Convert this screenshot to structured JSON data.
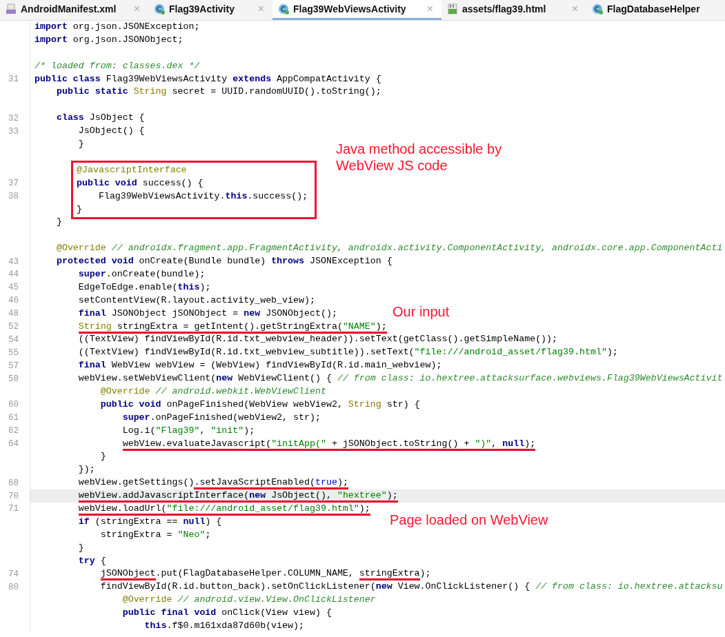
{
  "tabs": [
    {
      "label": "AndroidManifest.xml",
      "kind": "manifest",
      "selected": false,
      "closable": true
    },
    {
      "label": "Flag39Activity",
      "kind": "class",
      "selected": false,
      "closable": true
    },
    {
      "label": "Flag39WebViewsActivity",
      "kind": "class",
      "selected": true,
      "closable": true
    },
    {
      "label": "assets/flag39.html",
      "kind": "html",
      "selected": false,
      "closable": true
    },
    {
      "label": "FlagDatabaseHelper",
      "kind": "class",
      "selected": false,
      "closable": false
    }
  ],
  "close_glyph": "×",
  "lines": [
    {
      "kind": "line",
      "current": false,
      "tokens": [
        {
          "kind": "kw",
          "text": "import"
        },
        {
          "kind": "plain",
          "text": " org.json.JSONException;"
        }
      ]
    },
    {
      "kind": "line",
      "current": false,
      "tokens": [
        {
          "kind": "kw",
          "text": "import"
        },
        {
          "kind": "plain",
          "text": " org.json.JSONObject;"
        }
      ]
    },
    {
      "kind": "line",
      "current": false
    },
    {
      "kind": "line",
      "current": false,
      "tokens": [
        {
          "kind": "comment",
          "text": "/* loaded from: classes.dex */"
        }
      ]
    },
    {
      "kind": "line",
      "number": "31",
      "current": false,
      "tokens": [
        {
          "kind": "kw",
          "text": "public class"
        },
        {
          "kind": "plain",
          "text": " Flag39WebViewsActivity "
        },
        {
          "kind": "kw",
          "text": "extends"
        },
        {
          "kind": "plain",
          "text": " AppCompatActivity {"
        }
      ]
    },
    {
      "kind": "line",
      "current": false,
      "tokens": [
        {
          "kind": "kw",
          "text": "    public static"
        },
        {
          "kind": "type",
          "text": " String"
        },
        {
          "kind": "plain",
          "text": " secret = UUID.randomUUID().toString();"
        }
      ]
    },
    {
      "kind": "line",
      "current": false
    },
    {
      "kind": "line",
      "number": "32",
      "current": false,
      "tokens": [
        {
          "kind": "kw",
          "text": "    class"
        },
        {
          "kind": "plain",
          "text": " JsObject {"
        }
      ]
    },
    {
      "kind": "line",
      "number": "33",
      "current": false,
      "tokens": [
        {
          "kind": "plain",
          "text": "        JsObject() {"
        }
      ]
    },
    {
      "kind": "line",
      "current": false,
      "tokens": [
        {
          "kind": "plain",
          "text": "        }"
        }
      ]
    },
    {
      "kind": "line",
      "current": false
    },
    {
      "kind": "boxed",
      "lines": [
        {
          "kind": "line",
          "current": false,
          "tokens": [
            {
              "kind": "annotation",
              "text": "@JavascriptInterface"
            }
          ]
        },
        {
          "kind": "line",
          "number": "37",
          "current": false,
          "tokens": [
            {
              "kind": "kw",
              "text": "public void"
            },
            {
              "kind": "plain",
              "text": " success() {"
            }
          ]
        },
        {
          "kind": "line",
          "number": "38",
          "current": false,
          "tokens": [
            {
              "kind": "plain",
              "text": "    Flag39WebViewsActivity."
            },
            {
              "kind": "kw",
              "text": "this"
            },
            {
              "kind": "plain",
              "text": ".success();"
            }
          ]
        },
        {
          "kind": "line",
          "current": false,
          "tokens": [
            {
              "kind": "plain",
              "text": "}"
            }
          ]
        }
      ]
    },
    {
      "kind": "line",
      "current": false,
      "tokens": [
        {
          "kind": "plain",
          "text": "    }"
        }
      ]
    },
    {
      "kind": "line",
      "current": false
    },
    {
      "kind": "line",
      "current": false,
      "tokens": [
        {
          "kind": "annotation",
          "text": "    @Override"
        },
        {
          "kind": "comment",
          "text": " // androidx.fragment.app.FragmentActivity, androidx.activity.ComponentActivity, androidx.core.app.ComponentActi"
        }
      ]
    },
    {
      "kind": "line",
      "number": "43",
      "current": false,
      "tokens": [
        {
          "kind": "kw",
          "text": "    protected void"
        },
        {
          "kind": "plain",
          "text": " onCreate(Bundle bundle) "
        },
        {
          "kind": "kw",
          "text": "throws"
        },
        {
          "kind": "plain",
          "text": " JSONException {"
        }
      ]
    },
    {
      "kind": "line",
      "number": "44",
      "current": false,
      "tokens": [
        {
          "kind": "kw",
          "text": "        super"
        },
        {
          "kind": "plain",
          "text": ".onCreate(bundle);"
        }
      ]
    },
    {
      "kind": "line",
      "number": "45",
      "current": false,
      "tokens": [
        {
          "kind": "plain",
          "text": "        EdgeToEdge.enable("
        },
        {
          "kind": "kw",
          "text": "this"
        },
        {
          "kind": "plain",
          "text": ");"
        }
      ]
    },
    {
      "kind": "line",
      "number": "46",
      "current": false,
      "tokens": [
        {
          "kind": "plain",
          "text": "        setContentView(R.layout.activity_web_view);"
        }
      ]
    },
    {
      "kind": "line",
      "number": "48",
      "current": false,
      "tokens": [
        {
          "kind": "kw",
          "text": "        final"
        },
        {
          "kind": "plain",
          "text": " JSONObject jSONObject = "
        },
        {
          "kind": "kw",
          "text": "new"
        },
        {
          "kind": "plain",
          "text": " JSONObject();"
        }
      ]
    },
    {
      "kind": "line",
      "number": "52",
      "current": false,
      "tokens": [
        {
          "kind": "type",
          "text": "        String",
          "underlined": true
        },
        {
          "kind": "plain",
          "text": " stringExtra = getIntent().getStringExtra(",
          "underlined": true
        },
        {
          "kind": "string",
          "text": "\"NAME\"",
          "underlined": true
        },
        {
          "kind": "plain",
          "text": ");",
          "underlined": true
        }
      ]
    },
    {
      "kind": "line",
      "number": "54",
      "current": false,
      "tokens": [
        {
          "kind": "plain",
          "text": "        ((TextView) findViewById(R.id.txt_webview_header)).setText(getClass().getSimpleName());"
        }
      ]
    },
    {
      "kind": "line",
      "number": "55",
      "current": false,
      "tokens": [
        {
          "kind": "plain",
          "text": "        ((TextView) findViewById(R.id.txt_webview_subtitle)).setText("
        },
        {
          "kind": "string",
          "text": "\"file:///android_asset/flag39.html\""
        },
        {
          "kind": "plain",
          "text": ");"
        }
      ]
    },
    {
      "kind": "line",
      "number": "57",
      "current": false,
      "tokens": [
        {
          "kind": "kw",
          "text": "        final"
        },
        {
          "kind": "plain",
          "text": " WebView webView = (WebView) findViewById(R.id.main_webview);"
        }
      ]
    },
    {
      "kind": "line",
      "number": "58",
      "current": false,
      "tokens": [
        {
          "kind": "plain",
          "text": "        webView.setWebViewClient("
        },
        {
          "kind": "kw",
          "text": "new"
        },
        {
          "kind": "plain",
          "text": " WebViewClient() { "
        },
        {
          "kind": "comment",
          "text": "// from class: io.hextree.attacksurface.webviews.Flag39WebViewsActivit"
        }
      ]
    },
    {
      "kind": "line",
      "current": false,
      "tokens": [
        {
          "kind": "annotation",
          "text": "            @Override"
        },
        {
          "kind": "comment",
          "text": " // android.webkit.WebViewClient"
        }
      ]
    },
    {
      "kind": "line",
      "number": "60",
      "current": false,
      "tokens": [
        {
          "kind": "kw",
          "text": "            public void"
        },
        {
          "kind": "plain",
          "text": " onPageFinished(WebView webView2, "
        },
        {
          "kind": "type",
          "text": "String"
        },
        {
          "kind": "plain",
          "text": " str) {"
        }
      ]
    },
    {
      "kind": "line",
      "number": "61",
      "current": false,
      "tokens": [
        {
          "kind": "kw",
          "text": "                super"
        },
        {
          "kind": "plain",
          "text": ".onPageFinished(webView2, str);"
        }
      ]
    },
    {
      "kind": "line",
      "number": "62",
      "current": false,
      "tokens": [
        {
          "kind": "plain",
          "text": "                Log.i("
        },
        {
          "kind": "string",
          "text": "\"Flag39\""
        },
        {
          "kind": "plain",
          "text": ", "
        },
        {
          "kind": "string",
          "text": "\"init\""
        },
        {
          "kind": "plain",
          "text": ");"
        }
      ]
    },
    {
      "kind": "line",
      "number": "64",
      "current": false,
      "tokens": [
        {
          "kind": "plain",
          "text": "                webView.evaluateJavascript(",
          "underlined": true
        },
        {
          "kind": "string",
          "text": "\"initApp(\"",
          "underlined": true
        },
        {
          "kind": "plain",
          "text": " + jSONObject.toString() + ",
          "underlined": true
        },
        {
          "kind": "string",
          "text": "\")\"",
          "underlined": true
        },
        {
          "kind": "plain",
          "text": ", ",
          "underlined": true
        },
        {
          "kind": "kw",
          "text": "null",
          "underlined": true
        },
        {
          "kind": "plain",
          "text": ");",
          "underlined": true
        }
      ]
    },
    {
      "kind": "line",
      "current": false,
      "tokens": [
        {
          "kind": "plain",
          "text": "            }"
        }
      ]
    },
    {
      "kind": "line",
      "current": false,
      "tokens": [
        {
          "kind": "plain",
          "text": "        });"
        }
      ]
    },
    {
      "kind": "line",
      "number": "68",
      "current": false,
      "tokens": [
        {
          "kind": "plain",
          "text": "        webView.getSettings()"
        },
        {
          "kind": "plain",
          "text": ".setJavaScriptEnabled(",
          "underlined": true
        },
        {
          "kind": "literal",
          "text": "true",
          "underlined": true
        },
        {
          "kind": "plain",
          "text": ");",
          "underlined": true
        }
      ]
    },
    {
      "kind": "line",
      "number": "70",
      "current": true,
      "tokens": [
        {
          "kind": "plain",
          "text": "        webView.addJavascriptInterface(",
          "underlined": true
        },
        {
          "kind": "kw",
          "text": "new",
          "underlined": true
        },
        {
          "kind": "plain",
          "text": " JsObject(), ",
          "underlined": true
        },
        {
          "kind": "string",
          "text": "\"hextree\"",
          "underlined": true
        },
        {
          "kind": "plain",
          "text": ");",
          "underlined": true
        }
      ]
    },
    {
      "kind": "line",
      "number": "71",
      "current": false,
      "tokens": [
        {
          "kind": "plain",
          "text": "        webView.loadUrl(",
          "underlined": true
        },
        {
          "kind": "string",
          "text": "\"file:///android_asset/flag39.html\"",
          "underlined": true
        },
        {
          "kind": "plain",
          "text": ");",
          "underlined": true
        }
      ]
    },
    {
      "kind": "line",
      "current": false,
      "tokens": [
        {
          "kind": "kw",
          "text": "        if"
        },
        {
          "kind": "plain",
          "text": " (stringExtra == "
        },
        {
          "kind": "kw",
          "text": "null"
        },
        {
          "kind": "plain",
          "text": ") {"
        }
      ]
    },
    {
      "kind": "line",
      "current": false,
      "tokens": [
        {
          "kind": "plain",
          "text": "            stringExtra = "
        },
        {
          "kind": "string",
          "text": "\"Neo\""
        },
        {
          "kind": "plain",
          "text": ";"
        }
      ]
    },
    {
      "kind": "line",
      "current": false,
      "tokens": [
        {
          "kind": "plain",
          "text": "        }"
        }
      ]
    },
    {
      "kind": "line",
      "current": false,
      "tokens": [
        {
          "kind": "kw",
          "text": "        try"
        },
        {
          "kind": "plain",
          "text": " {"
        }
      ]
    },
    {
      "kind": "line",
      "number": "74",
      "current": false,
      "tokens": [
        {
          "kind": "plain",
          "text": "            jSONObject",
          "underlined": true
        },
        {
          "kind": "plain",
          "text": ".put(FlagDatabaseHelper.COLUMN_NAME, "
        },
        {
          "kind": "plain",
          "text": "stringExtra",
          "underlined": true
        },
        {
          "kind": "plain",
          "text": ");"
        }
      ]
    },
    {
      "kind": "line",
      "number": "80",
      "current": false,
      "tokens": [
        {
          "kind": "plain",
          "text": "            findViewById(R.id.button_back).setOnClickListener("
        },
        {
          "kind": "kw",
          "text": "new"
        },
        {
          "kind": "plain",
          "text": " View.OnClickListener() { "
        },
        {
          "kind": "comment",
          "text": "// from class: io.hextree.attacksu"
        }
      ]
    },
    {
      "kind": "line",
      "current": false,
      "tokens": [
        {
          "kind": "annotation",
          "text": "                @Override"
        },
        {
          "kind": "comment",
          "text": " // android.view.View.OnClickListener"
        }
      ]
    },
    {
      "kind": "line",
      "current": false,
      "tokens": [
        {
          "kind": "kw",
          "text": "                public final void"
        },
        {
          "kind": "plain",
          "text": " onClick(View view) {"
        }
      ]
    },
    {
      "kind": "line",
      "current": false,
      "tokens": [
        {
          "kind": "kw",
          "text": "                    this"
        },
        {
          "kind": "plain",
          "text": ".f$0.m161xda87d60b(view);"
        }
      ]
    }
  ],
  "notes": [
    {
      "text": "Java method accessible by WebView JS code"
    },
    {
      "text": "Our input"
    },
    {
      "text": "Page loaded on WebView"
    }
  ]
}
